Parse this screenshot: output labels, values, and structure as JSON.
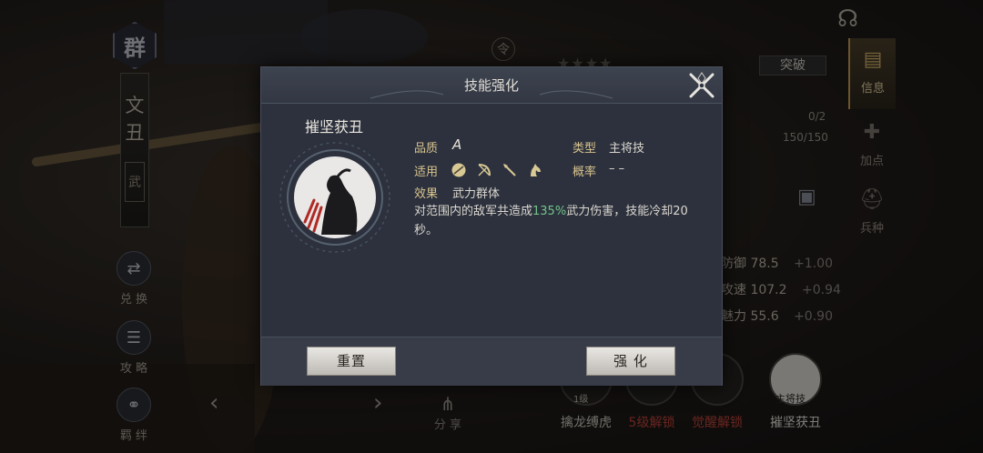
{
  "background": {
    "faction_char": "群",
    "hero_name_chars": [
      "文",
      "丑"
    ],
    "hero_type": "武",
    "side_buttons": [
      {
        "icon": "swap-icon",
        "label": "兑 换"
      },
      {
        "icon": "strategy-icon",
        "label": "攻 略"
      },
      {
        "icon": "bond-icon",
        "label": "羁 绊"
      }
    ],
    "token_char": "令",
    "stars": "★★★★",
    "breakthrough_label": "突破",
    "progress_1": "0/2",
    "progress_2": "150/150",
    "right_tabs": [
      {
        "icon": "scroll-icon",
        "label": "信息",
        "active": true
      },
      {
        "icon": "plus-points-icon",
        "label": "加点",
        "active": false
      },
      {
        "icon": "helmet-icon",
        "label": "兵种",
        "active": false
      }
    ],
    "stats": [
      {
        "name": "防御",
        "value": "78.5",
        "bonus": "+1.00"
      },
      {
        "name": "攻速",
        "value": "107.2",
        "bonus": "+0.94"
      },
      {
        "name": "魅力",
        "value": "55.6",
        "bonus": "+0.90"
      }
    ],
    "skill_slots": [
      {
        "label": "擒龙缚虎",
        "color": "#cfcac0",
        "badge": "1级"
      },
      {
        "label": "5级解锁",
        "color": "#c0443a",
        "badge": ""
      },
      {
        "label": "觉醒解锁",
        "color": "#c0443a",
        "badge": ""
      },
      {
        "label": "摧坚获丑",
        "color": "#e6e2d8",
        "badge": "主将技"
      }
    ],
    "share_label": "分 享"
  },
  "modal": {
    "title": "技能强化",
    "skill_name": "摧坚获丑",
    "quality_label": "品质",
    "quality_value": "A",
    "type_label": "类型",
    "type_value": "主将技",
    "apply_label": "适用",
    "apply_icons": [
      "shield-icon",
      "bow-icon",
      "spear-icon",
      "horse-icon"
    ],
    "rate_label": "概率",
    "rate_value": "– –",
    "effect_label": "效果",
    "effect_value": "武力群体",
    "desc_pre": "对范围内的敌军共造成",
    "desc_highlight": "135%",
    "desc_post": "武力伤害，技能冷却20秒。",
    "reset_label": "重置",
    "enhance_label": "强 化"
  },
  "colors": {
    "label_gold": "#d9c48e",
    "highlight_green": "#72c48a",
    "locked_red": "#c0443a",
    "modal_bg": "#2c313d"
  }
}
